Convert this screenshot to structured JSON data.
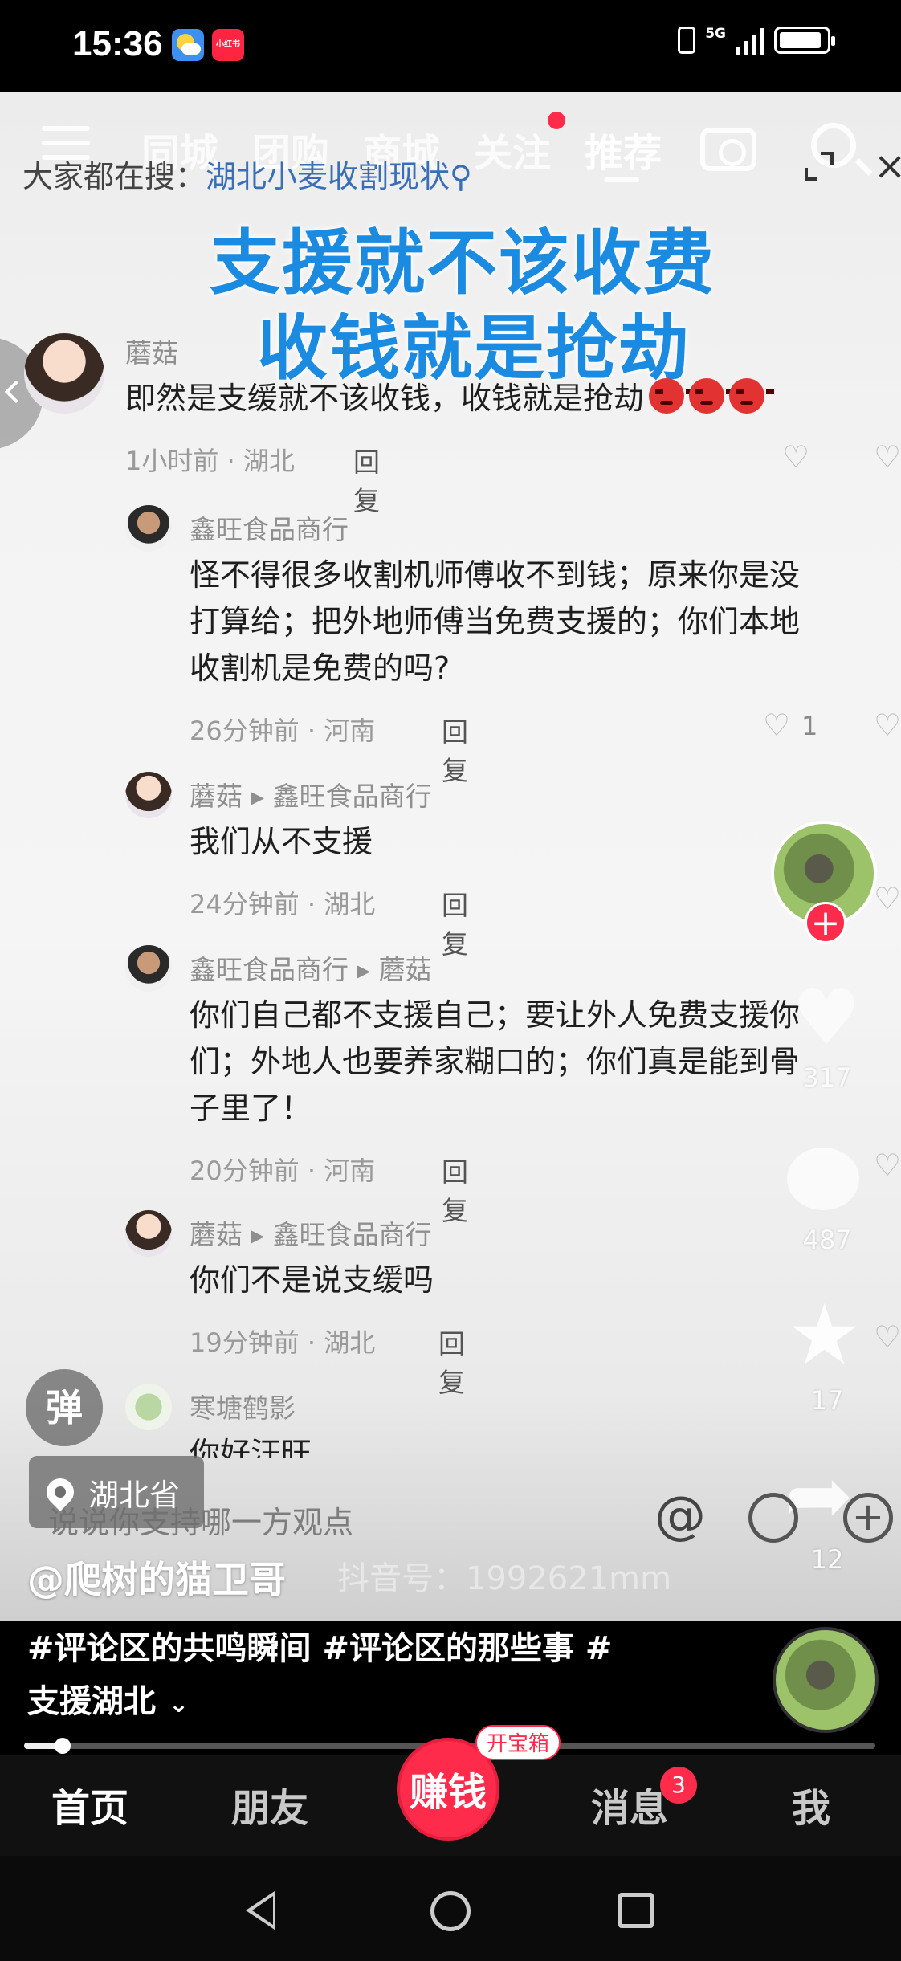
{
  "status_bar": {
    "time": "15:36",
    "network": "5G",
    "app_badge": "小红书"
  },
  "top_nav": {
    "tabs": [
      "同城",
      "团购",
      "商城",
      "关注",
      "推荐"
    ],
    "active_tab": "推荐"
  },
  "search_hint": {
    "prefix": "大家都在搜：",
    "keyword": "湖北小麦收割现状"
  },
  "headline": {
    "line1": "支援就不该收费",
    "line2": "收钱就是抢劫"
  },
  "comments": [
    {
      "name": "蘑菇",
      "text": "即然是支缓就不该收钱，收钱就是抢劫",
      "time_loc": "1小时前 · 湖北",
      "reply": "回复"
    },
    {
      "name": "鑫旺食品商行",
      "text_lines": [
        "怪不得很多收割机师傅收不到钱；原来你是没",
        "打算给；把外地师傅当免费支援的；你们本地",
        "收割机是免费的吗?"
      ],
      "time_loc": "26分钟前 · 河南",
      "reply": "回复",
      "likes": "1"
    },
    {
      "name": "蘑菇",
      "reply_to": "鑫旺食品商行",
      "text": "我们从不支援",
      "time_loc": "24分钟前 · 湖北",
      "reply": "回复"
    },
    {
      "name": "鑫旺食品商行",
      "reply_to": "蘑菇",
      "text_lines": [
        "你们自己都不支援自己；要让外人免费支援你",
        "们；外地人也要养家糊口的；你们真是能到骨",
        "子里了！"
      ],
      "time_loc": "20分钟前 · 河南",
      "reply": "回复"
    },
    {
      "name": "蘑菇",
      "reply_to": "鑫旺食品商行",
      "text": "你们不是说支缓吗",
      "time_loc": "19分钟前 · 湖北",
      "reply": "回复"
    },
    {
      "name": "寒塘鹤影",
      "text": "你好汪旺"
    }
  ],
  "actions": {
    "like_count": "317",
    "comment_count": "487",
    "favorite_count": "17",
    "share_count": "12",
    "follow_symbol": "+"
  },
  "danmu_label": "弹",
  "location": "湖北省",
  "comment_input_placeholder": "说说你支持哪一方观点",
  "watermark": "抖音号：1992621mm",
  "author_handle": "@爬树的猫卫哥",
  "caption": {
    "line1": "#评论区的共鸣瞬间 #评论区的那些事 #",
    "line2": "支援湖北"
  },
  "progress": {
    "fraction": 0.045
  },
  "tabbar": {
    "home": "首页",
    "friends": "朋友",
    "earn": "赚钱",
    "treasure": "开宝箱",
    "messages": "消息",
    "messages_badge": "3",
    "me": "我"
  },
  "colors": {
    "accent": "#ff2b4b",
    "headline": "#1a8be0",
    "search_keyword": "#3a6fb5"
  }
}
